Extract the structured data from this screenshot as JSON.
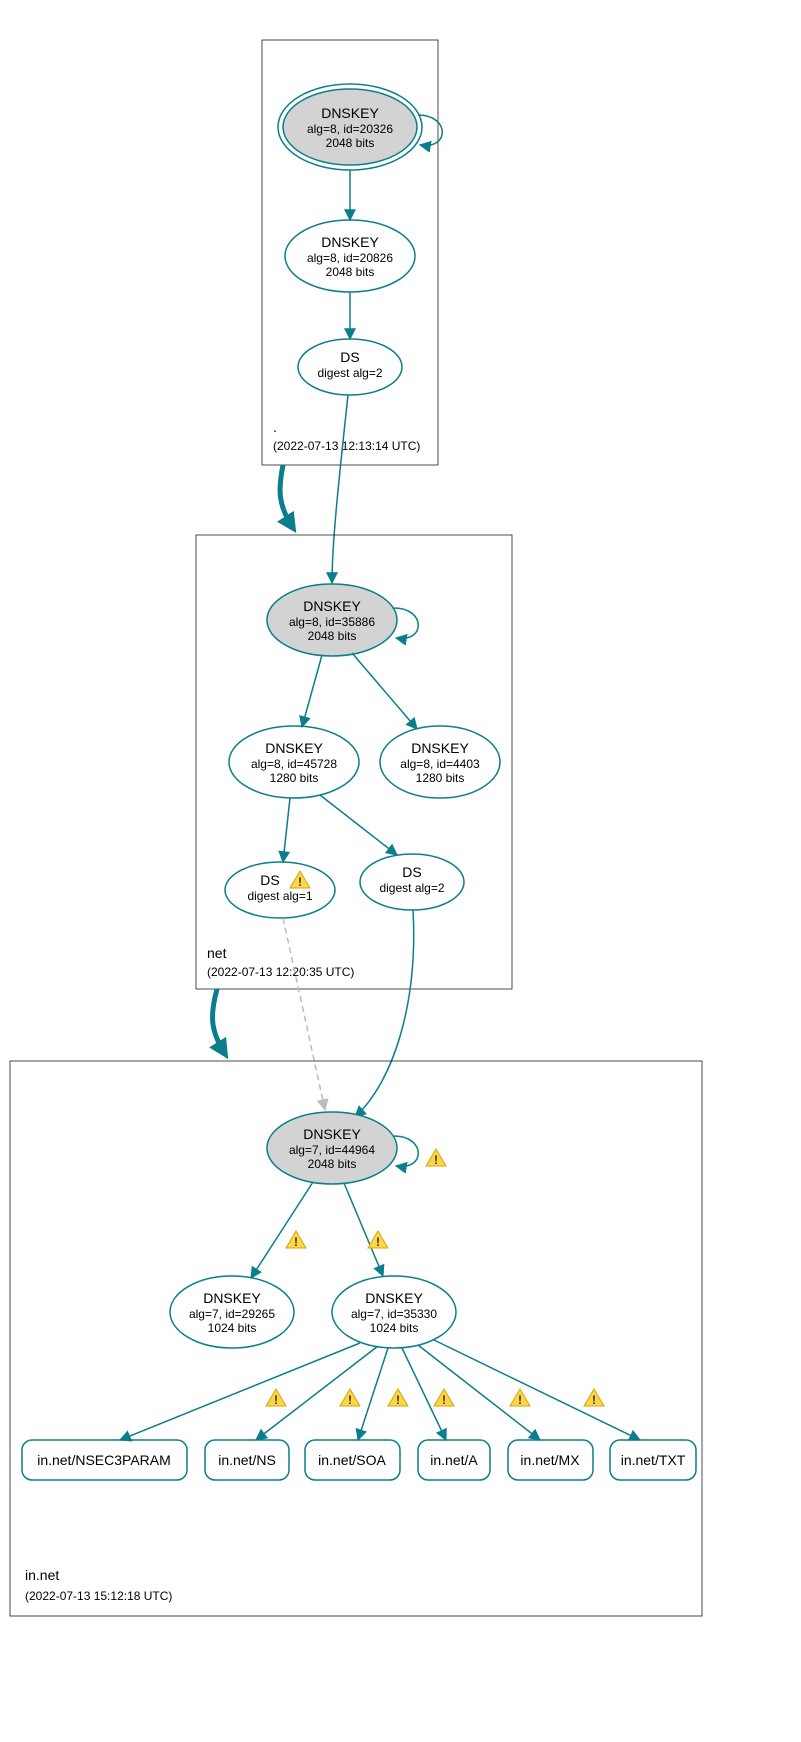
{
  "zones": {
    "root": {
      "label": ".",
      "timestamp": "(2022-07-13 12:13:14 UTC)"
    },
    "net": {
      "label": "net",
      "timestamp": "(2022-07-13 12:20:35 UTC)"
    },
    "innet": {
      "label": "in.net",
      "timestamp": "(2022-07-13 15:12:18 UTC)"
    }
  },
  "nodes": {
    "root_ksk": {
      "title": "DNSKEY",
      "line2": "alg=8, id=20326",
      "line3": "2048 bits"
    },
    "root_zsk": {
      "title": "DNSKEY",
      "line2": "alg=8, id=20826",
      "line3": "2048 bits"
    },
    "root_ds": {
      "title": "DS",
      "line2": "digest alg=2"
    },
    "net_ksk": {
      "title": "DNSKEY",
      "line2": "alg=8, id=35886",
      "line3": "2048 bits"
    },
    "net_zsk": {
      "title": "DNSKEY",
      "line2": "alg=8, id=45728",
      "line3": "1280 bits"
    },
    "net_zsk2": {
      "title": "DNSKEY",
      "line2": "alg=8, id=4403",
      "line3": "1280 bits"
    },
    "net_ds1": {
      "title": "DS",
      "line2": "digest alg=1"
    },
    "net_ds2": {
      "title": "DS",
      "line2": "digest alg=2"
    },
    "innet_ksk": {
      "title": "DNSKEY",
      "line2": "alg=7, id=44964",
      "line3": "2048 bits"
    },
    "innet_zsk": {
      "title": "DNSKEY",
      "line2": "alg=7, id=29265",
      "line3": "1024 bits"
    },
    "innet_zsk2": {
      "title": "DNSKEY",
      "line2": "alg=7, id=35330",
      "line3": "1024 bits"
    }
  },
  "rrsets": {
    "nsec3param": "in.net/NSEC3PARAM",
    "ns": "in.net/NS",
    "soa": "in.net/SOA",
    "a": "in.net/A",
    "mx": "in.net/MX",
    "txt": "in.net/TXT"
  }
}
